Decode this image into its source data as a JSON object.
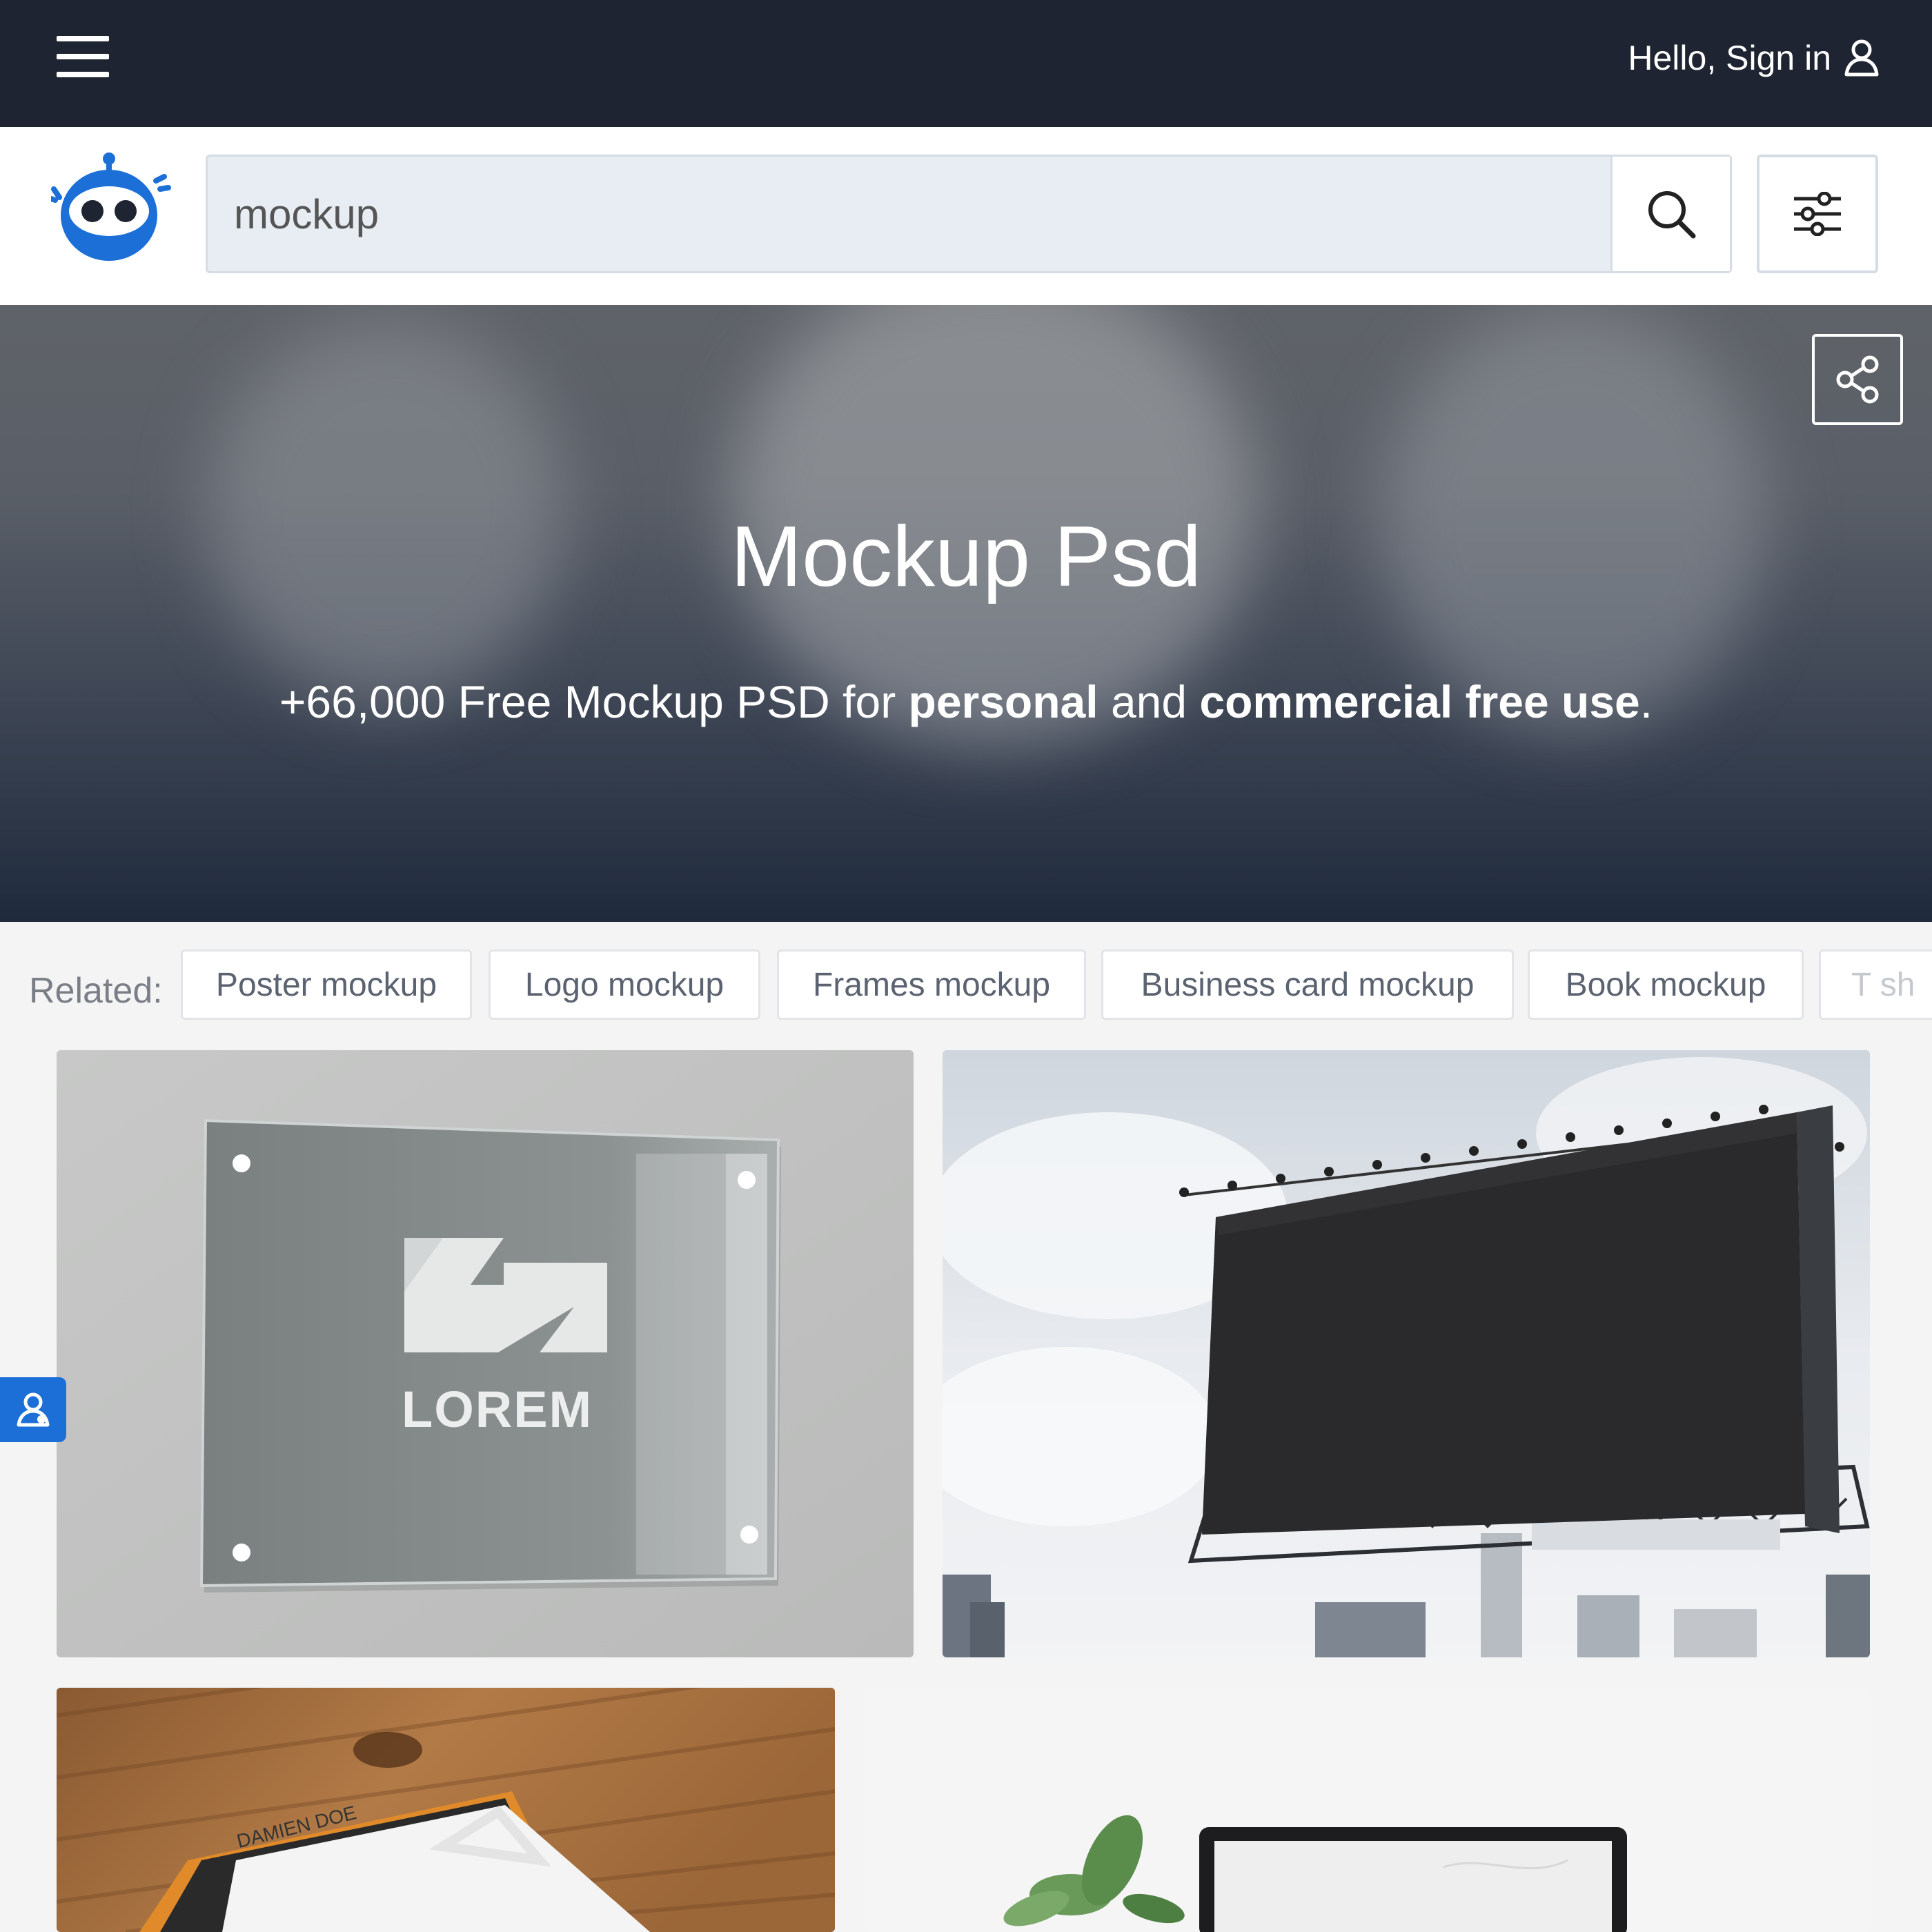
{
  "topbar": {
    "signin_label": "Hello, Sign in"
  },
  "search": {
    "query": "mockup"
  },
  "hero": {
    "title": "Mockup Psd",
    "subtitle_prefix": "+66,000 Free Mockup PSD for ",
    "subtitle_bold1": "personal",
    "subtitle_mid": " and ",
    "subtitle_bold2": "commercial free use",
    "subtitle_suffix": "."
  },
  "related": {
    "label": "Related:",
    "chips": [
      "Poster mockup",
      "Logo mockup",
      "Frames mockup",
      "Business card mockup",
      "Book mockup",
      "T sh"
    ]
  },
  "cards": {
    "glass_sign_text": "LOREM",
    "business_card_name": "DAMIEN DOE"
  },
  "colors": {
    "topbar": "#1e2431",
    "accent": "#1b6fd6",
    "search_field": "#e8edf3"
  },
  "icons": [
    "menu-icon",
    "user-icon",
    "logo-robot-icon",
    "search-icon",
    "sliders-icon",
    "share-icon",
    "contact-icon"
  ]
}
